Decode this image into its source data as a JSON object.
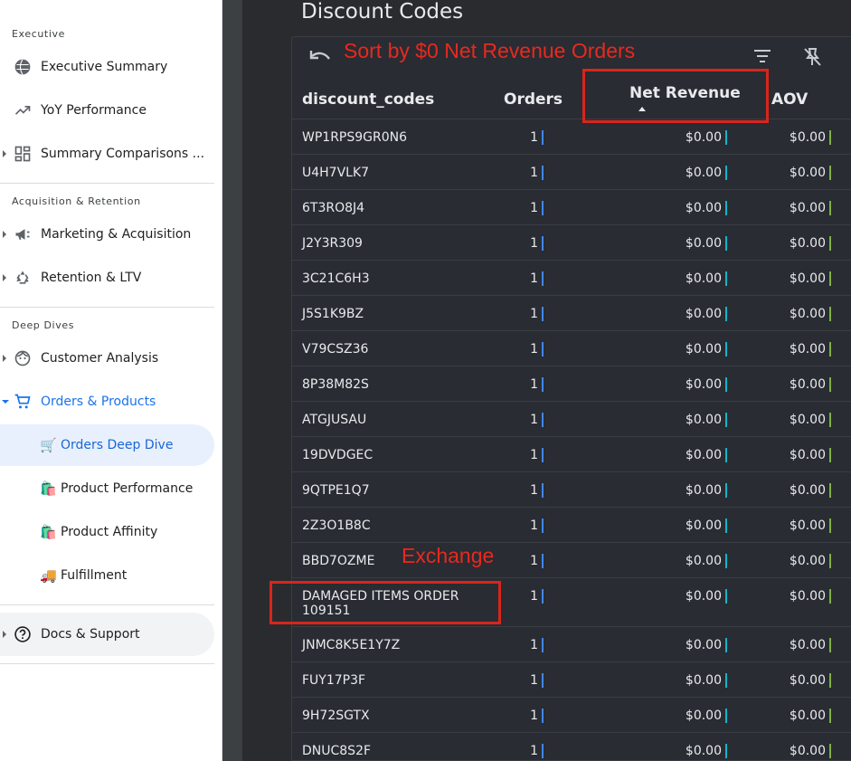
{
  "sidebar": {
    "sections": [
      "Executive",
      "Acquisition & Retention",
      "Deep Dives"
    ],
    "items": [
      {
        "label": "Executive Summary",
        "icon": "globe-icon"
      },
      {
        "label": "YoY Performance",
        "icon": "trending-up-icon"
      },
      {
        "label": "Summary Comparisons ...",
        "icon": "dashboard-icon"
      },
      {
        "label": "Marketing & Acquisition",
        "icon": "megaphone-icon"
      },
      {
        "label": "Retention & LTV",
        "icon": "recycle-icon"
      },
      {
        "label": "Customer Analysis",
        "icon": "face-icon"
      },
      {
        "label": "Orders & Products",
        "icon": "cart-icon"
      },
      {
        "label": "Docs & Support",
        "icon": "help-icon"
      }
    ],
    "subitems": [
      {
        "label": "Orders Deep Dive",
        "emoji": "🛒"
      },
      {
        "label": "Product Performance",
        "emoji": "🛍️"
      },
      {
        "label": "Product Affinity",
        "emoji": "🛍️"
      },
      {
        "label": "Fulfillment",
        "emoji": "🚚"
      }
    ]
  },
  "main": {
    "title": "Discount Codes",
    "columns": [
      "discount_codes",
      "Orders",
      "Net Revenue",
      "AOV"
    ],
    "rows": [
      {
        "code": "WP1RPS9GR0N6",
        "orders": "1",
        "net_revenue": "$0.00",
        "aov": "$0.00"
      },
      {
        "code": "U4H7VLK7",
        "orders": "1",
        "net_revenue": "$0.00",
        "aov": "$0.00"
      },
      {
        "code": "6T3RO8J4",
        "orders": "1",
        "net_revenue": "$0.00",
        "aov": "$0.00"
      },
      {
        "code": "J2Y3R309",
        "orders": "1",
        "net_revenue": "$0.00",
        "aov": "$0.00"
      },
      {
        "code": "3C21C6H3",
        "orders": "1",
        "net_revenue": "$0.00",
        "aov": "$0.00"
      },
      {
        "code": "J5S1K9BZ",
        "orders": "1",
        "net_revenue": "$0.00",
        "aov": "$0.00"
      },
      {
        "code": "V79CSZ36",
        "orders": "1",
        "net_revenue": "$0.00",
        "aov": "$0.00"
      },
      {
        "code": "8P38M82S",
        "orders": "1",
        "net_revenue": "$0.00",
        "aov": "$0.00"
      },
      {
        "code": "ATGJUSAU",
        "orders": "1",
        "net_revenue": "$0.00",
        "aov": "$0.00"
      },
      {
        "code": "19DVDGEC",
        "orders": "1",
        "net_revenue": "$0.00",
        "aov": "$0.00"
      },
      {
        "code": "9QTPE1Q7",
        "orders": "1",
        "net_revenue": "$0.00",
        "aov": "$0.00"
      },
      {
        "code": "2Z3O1B8C",
        "orders": "1",
        "net_revenue": "$0.00",
        "aov": "$0.00"
      },
      {
        "code": "BBD7OZME",
        "orders": "1",
        "net_revenue": "$0.00",
        "aov": "$0.00"
      },
      {
        "code": "DAMAGED ITEMS ORDER 109151",
        "orders": "1",
        "net_revenue": "$0.00",
        "aov": "$0.00"
      },
      {
        "code": "JNMC8K5E1Y7Z",
        "orders": "1",
        "net_revenue": "$0.00",
        "aov": "$0.00"
      },
      {
        "code": "FUY17P3F",
        "orders": "1",
        "net_revenue": "$0.00",
        "aov": "$0.00"
      },
      {
        "code": "9H72SGTX",
        "orders": "1",
        "net_revenue": "$0.00",
        "aov": "$0.00"
      },
      {
        "code": "DNUC8S2F",
        "orders": "1",
        "net_revenue": "$0.00",
        "aov": "$0.00"
      }
    ],
    "toolbar_icons": [
      "undo-icon",
      "filter-icon",
      "pin-off-icon"
    ]
  },
  "annotations": {
    "sort_note": "Sort by $0 Net Revenue Orders",
    "exchange_note": "Exchange"
  },
  "colors": {
    "accent": "#1a73e8",
    "annotation_red": "#e8291f",
    "panel_bg": "#292c32"
  }
}
